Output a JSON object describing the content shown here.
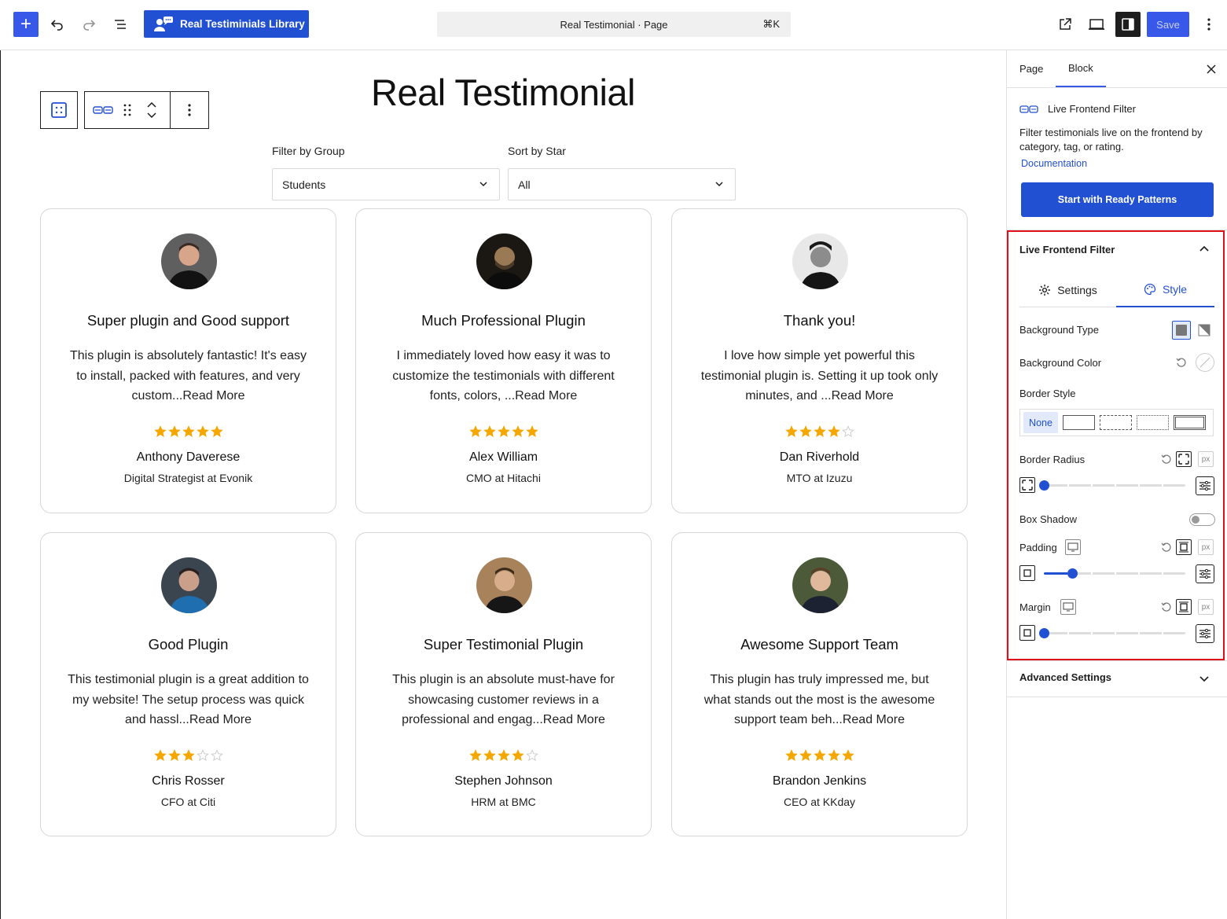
{
  "topbar": {
    "plugin_button_label": "Real Testiminials Library",
    "command_bar_title": "Real Testimonial · Page",
    "command_bar_shortcut": "⌘K",
    "save_label": "Save"
  },
  "canvas": {
    "page_title": "Real Testimonial",
    "filters": {
      "group_label": "Filter by Group",
      "group_value": "Students",
      "star_label": "Sort by Star",
      "star_value": "All"
    },
    "cards": [
      {
        "title": "Super plugin and Good support",
        "body": "This plugin is absolutely fantastic! It's easy to install, packed with features, and very custom...Read More",
        "rating": 5,
        "name": "Anthony Daverese",
        "role": "Digital Strategist at Evonik"
      },
      {
        "title": "Much Professional Plugin",
        "body": "I immediately loved how easy it was to customize the testimonials with different fonts, colors, ...Read More",
        "rating": 5,
        "name": "Alex William",
        "role": "CMO at Hitachi"
      },
      {
        "title": "Thank you!",
        "body": "I love how simple yet powerful this testimonial plugin is. Setting it up took only minutes, and ...Read More",
        "rating": 4,
        "name": "Dan Riverhold",
        "role": "MTO at Izuzu"
      },
      {
        "title": "Good Plugin",
        "body": "This testimonial plugin is a great addition to my website! The setup process was quick and hassl...Read More",
        "rating": 3,
        "name": "Chris Rosser",
        "role": "CFO at Citi"
      },
      {
        "title": "Super Testimonial Plugin",
        "body": "This plugin is an absolute must-have for showcasing customer reviews in a professional and engag...Read More",
        "rating": 4,
        "name": "Stephen Johnson",
        "role": "HRM at BMC"
      },
      {
        "title": "Awesome Support Team",
        "body": "This plugin has truly impressed me, but what stands out the most is the awesome support team beh...Read More",
        "rating": 5,
        "name": "Brandon Jenkins",
        "role": "CEO at KKday"
      }
    ]
  },
  "sidebar": {
    "tabs": [
      "Page",
      "Block"
    ],
    "active_tab": "Block",
    "block_name": "Live Frontend Filter",
    "block_description": "Filter testimonials live on the frontend by category, tag, or rating.",
    "documentation_link": "Documentation",
    "patterns_button": "Start with Ready Patterns",
    "panel_title": "Live Frontend Filter",
    "panel_tabs": {
      "settings": "Settings",
      "style": "Style",
      "active": "Style"
    },
    "labels": {
      "background_type": "Background Type",
      "background_color": "Background Color",
      "border_style": "Border Style",
      "border_style_none": "None",
      "border_radius": "Border Radius",
      "box_shadow": "Box Shadow",
      "padding": "Padding",
      "margin": "Margin",
      "unit": "px"
    },
    "values": {
      "border_radius": 0,
      "box_shadow_enabled": false,
      "padding": 0.2,
      "margin": 0
    },
    "advanced_settings": "Advanced Settings"
  },
  "colors": {
    "accent": "#3858e9",
    "brand": "#2150d3",
    "star": "#f5a700",
    "highlight": "#e0101a"
  }
}
